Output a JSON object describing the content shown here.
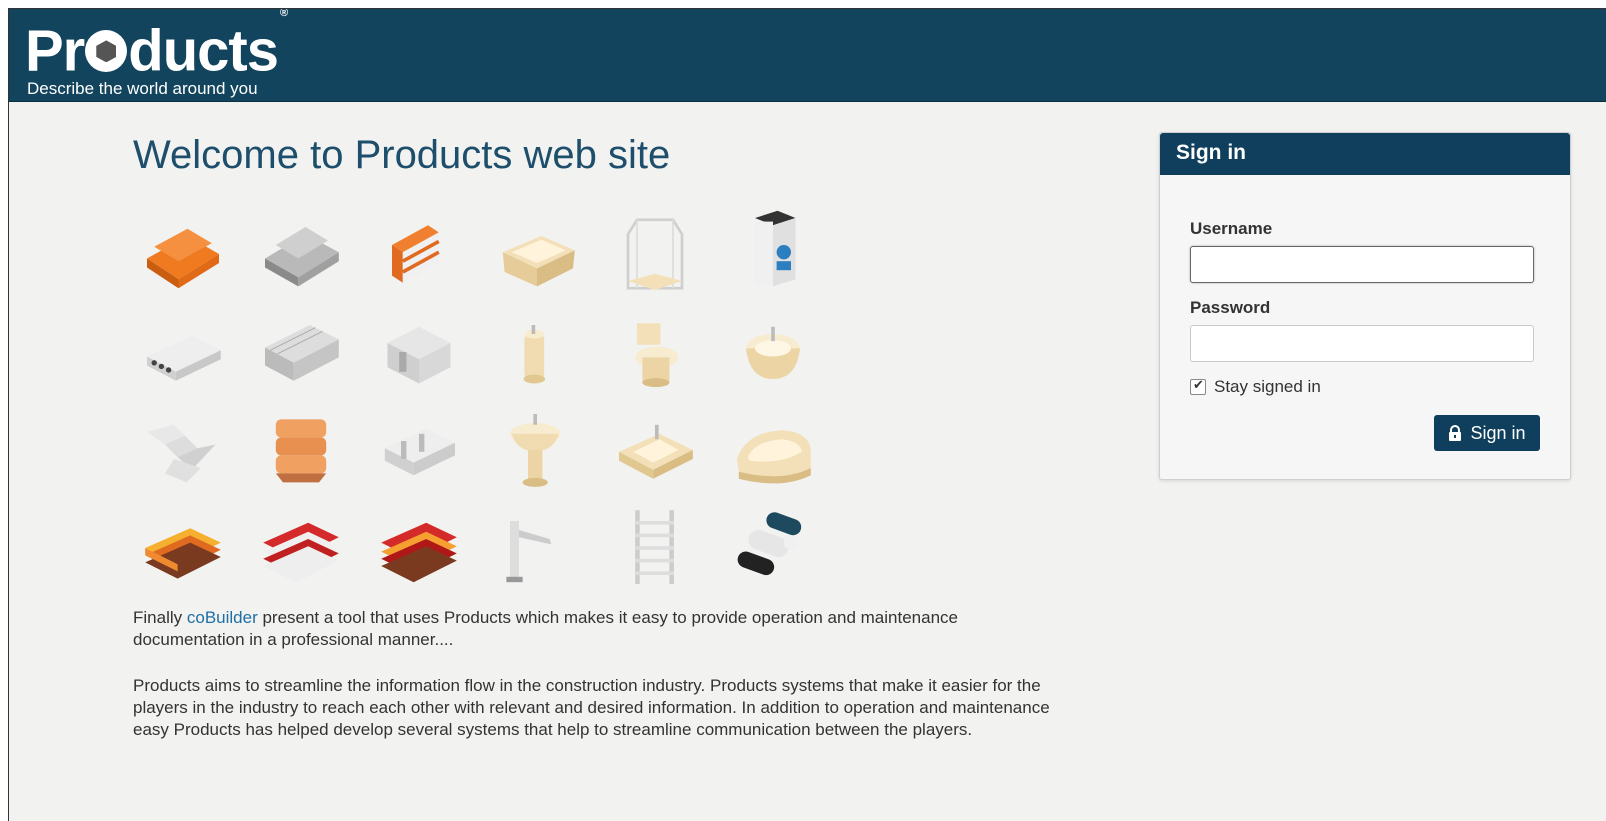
{
  "header": {
    "logo_text_1": "Pr",
    "logo_text_2": "ducts",
    "logo_mark": "®",
    "tagline": "Describe the world around you"
  },
  "main": {
    "title": "Welcome to Products web site",
    "para1_prefix": "Finally ",
    "para1_link": "coBuilder",
    "para1_suffix": " present a tool that uses Products which makes it easy to provide operation and maintenance documentation in a professional manner....",
    "para2": "Products aims to streamline the information flow in the construction industry. Products systems that make it easier for the players in the industry to reach each other with relevant and desired information. In addition to operation and maintenance easy Products has helped develop several systems that help to streamline communication between the players."
  },
  "products": [
    {
      "name": "bricks-pallet-icon"
    },
    {
      "name": "concrete-blocks-pallet-icon"
    },
    {
      "name": "brick-wall-icon"
    },
    {
      "name": "bathtub-icon"
    },
    {
      "name": "shower-cabin-icon"
    },
    {
      "name": "water-heater-icon"
    },
    {
      "name": "hollow-core-slab-icon"
    },
    {
      "name": "concrete-beams-icon"
    },
    {
      "name": "concrete-element-icon"
    },
    {
      "name": "urinal-icon"
    },
    {
      "name": "toilet-icon"
    },
    {
      "name": "bidet-icon"
    },
    {
      "name": "staircase-icon"
    },
    {
      "name": "insulation-bags-icon"
    },
    {
      "name": "concrete-stair-icon"
    },
    {
      "name": "pedestal-sink-icon"
    },
    {
      "name": "wash-basin-icon"
    },
    {
      "name": "corner-bathtub-icon"
    },
    {
      "name": "roof-tiles-orange-icon"
    },
    {
      "name": "roof-tiles-red-icon"
    },
    {
      "name": "roof-tiles-red-stack-icon"
    },
    {
      "name": "faucet-icon"
    },
    {
      "name": "towel-radiator-icon"
    },
    {
      "name": "pipe-rolls-icon"
    }
  ],
  "signin": {
    "title": "Sign in",
    "username_label": "Username",
    "username_value": "",
    "password_label": "Password",
    "password_value": "",
    "stay_label": "Stay signed in",
    "stay_checked": true,
    "button_label": "Sign in"
  },
  "colors": {
    "header_bg": "#12445e",
    "accent": "#0f3f5c",
    "link": "#1f6fa5"
  }
}
